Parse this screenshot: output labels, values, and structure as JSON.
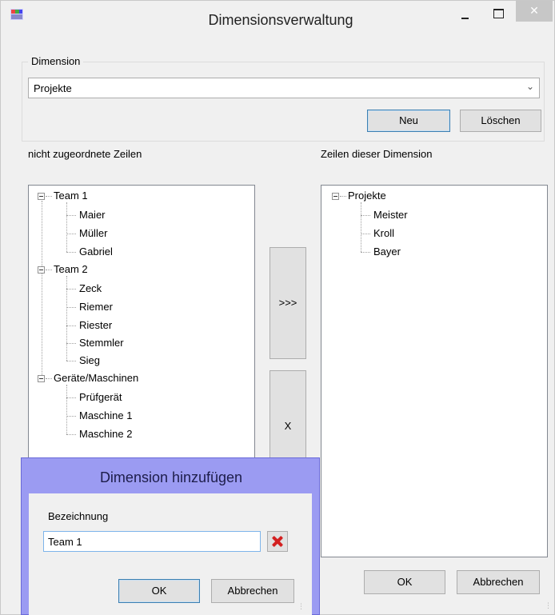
{
  "window": {
    "title": "Dimensionsverwaltung",
    "close_glyph": "✕"
  },
  "dimension_group": {
    "legend": "Dimension",
    "selected": "Projekte",
    "new_label": "Neu",
    "delete_label": "Löschen"
  },
  "left_panel": {
    "header": "nicht zugeordnete Zeilen",
    "groups": [
      {
        "label": "Team 1",
        "children": [
          "Maier",
          "Müller",
          "Gabriel"
        ]
      },
      {
        "label": "Team 2",
        "children": [
          "Zeck",
          "Riemer",
          "Riester",
          "Stemmler",
          "Sieg"
        ]
      },
      {
        "label": "Geräte/Maschinen",
        "children": [
          "Prüfgerät",
          "Maschine 1",
          "Maschine 2"
        ]
      }
    ]
  },
  "right_panel": {
    "header": "Zeilen dieser Dimension",
    "groups": [
      {
        "label": "Projekte",
        "children": [
          "Meister",
          "Kroll",
          "Bayer"
        ]
      }
    ]
  },
  "transfer": {
    "move_label": ">>>",
    "remove_label": "X"
  },
  "footer": {
    "ok_label": "OK",
    "cancel_label": "Abbrechen"
  },
  "dialog": {
    "title": "Dimension hinzufügen",
    "field_label": "Bezeichnung",
    "field_value": "Team 1",
    "ok_label": "OK",
    "cancel_label": "Abbrechen",
    "accent": "#9b9bf2"
  }
}
